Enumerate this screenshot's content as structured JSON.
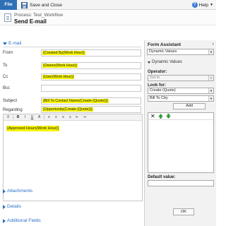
{
  "ribbon": {
    "file_label": "File",
    "save_close_label": "Save and Close",
    "help_label": "Help"
  },
  "header": {
    "process_label": "Process: Test_Workflow",
    "title": "Send E-mail"
  },
  "email_section": {
    "title": "E-mail"
  },
  "fields": [
    {
      "label": "From",
      "value": "{Created By(Work Hour)}"
    },
    {
      "label": "To",
      "value": "{Owner(Work Hour)}"
    },
    {
      "label": "Cc",
      "value": "{User(Work Hour)}"
    },
    {
      "label": "Bcc",
      "value": ""
    },
    {
      "label": "Subject",
      "value": "{Bill To Contact Name(Create (Quote))}"
    },
    {
      "label": "Regarding",
      "value": "{Opportunity(Create (Quote))}"
    }
  ],
  "editor": {
    "toolbar": [
      "X",
      "B",
      "I",
      "U",
      "A",
      "≡",
      "≡",
      "≡",
      "≡",
      "⇤",
      "⇥"
    ],
    "body_value": "{Approved Hours(Work Hour)}"
  },
  "collapsed_sections": [
    "Attachments",
    "Details",
    "Additional Fields"
  ],
  "form_assistant": {
    "title": "Form Assistant",
    "top_select": "Dynamic Values",
    "dynamic_values_label": "Dynamic Values",
    "operator_label": "Operator:",
    "operator_value": "Set to",
    "look_for_label": "Look for:",
    "look_for_entity": "Create (Quote)",
    "look_for_field": "Bill To City",
    "add_label": "Add",
    "default_value_label": "Default value:",
    "ok_label": "OK"
  },
  "colors": {
    "highlight": "#f7f300",
    "link": "#2a6fc9",
    "file_tab": "#2f6fb6"
  }
}
